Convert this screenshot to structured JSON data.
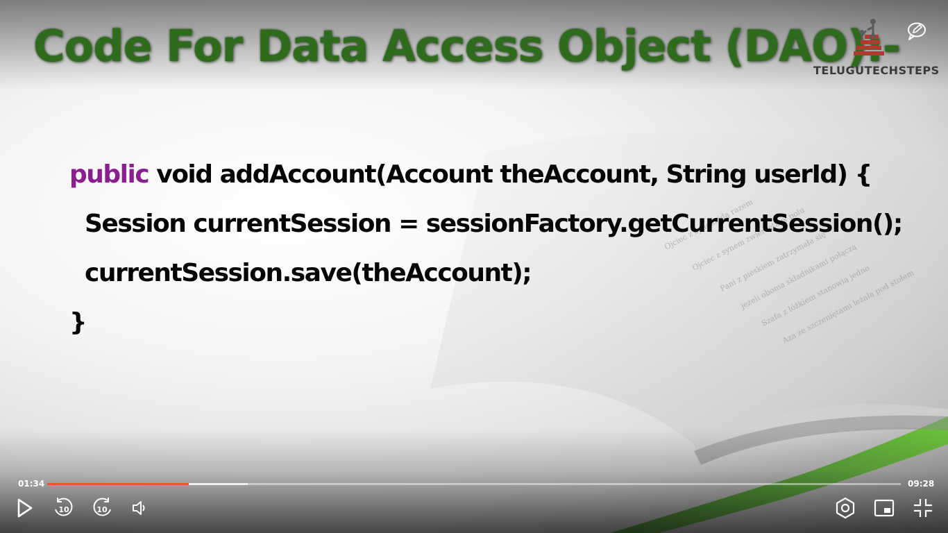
{
  "slide": {
    "title": "Code For Data Access Object (DAO):-",
    "code": {
      "line1_keyword": "public",
      "line1_rest": " void addAccount(Account theAccount, String userId) {",
      "line2": "Session currentSession = sessionFactory.getCurrentSession();",
      "line3": "currentSession.save(theAccount);",
      "line4": "}"
    }
  },
  "logo": {
    "text": "TELUGUTECHSTEPS"
  },
  "player": {
    "current_time": "01:34",
    "duration": "09:28",
    "progress_fraction": 0.1655,
    "buffered_fraction": 0.235,
    "skip_back_seconds": "10",
    "skip_forward_seconds": "10",
    "icons": {
      "play": "play-icon",
      "rewind": "rewind-10-icon",
      "forward": "forward-10-icon",
      "volume": "volume-icon",
      "settings": "settings-hexagon-icon",
      "pip": "picture-in-picture-icon",
      "exit_fullscreen": "exit-fullscreen-icon",
      "annotate": "pencil-comment-icon"
    },
    "colors": {
      "played": "#e8572a",
      "controls": "#ffffff"
    }
  },
  "colors": {
    "title": "#2f6b1d",
    "keyword": "#8a1f8f",
    "code": "#050505",
    "logo_accent": "#b03a2e"
  }
}
